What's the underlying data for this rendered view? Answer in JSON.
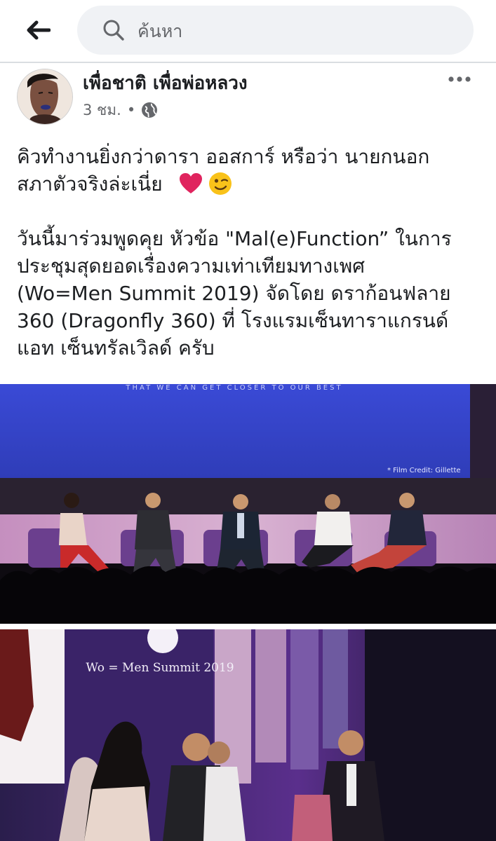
{
  "search": {
    "placeholder": "ค้นหา"
  },
  "post": {
    "author": "เพื่อชาติ เพื่อพ่อหลวง",
    "time": "3 ชม.",
    "separator": "•",
    "text_lines_1": [
      "คิวทำงานยิ่งกว่าดารา  ออสการ์ หรือว่า นายกนอก",
      "สภาตัวจริงล่ะเนี่ย"
    ],
    "text_lines_2": [
      "วันนี้มาร่วมพูดคุย หัวข้อ \"Mal(e)Function” ในการ",
      "ประชุมสุดยอดเรื่องความเท่าเทียมทางเพศ",
      "(Wo=Men Summit 2019) จัดโดย ดราก้อนฟลาย",
      "360 (Dragonfly 360) ที่ โรงแรมเซ็นทาราแกรนด์",
      "แอท เซ็นทรัลเวิลด์ ครับ"
    ]
  },
  "photo1": {
    "screen_caption": "THAT WE CAN GET CLOSER TO OUR BEST",
    "film_credit": "* Film Credit: Gillette"
  },
  "photo2": {
    "banner_text": "Wo = Men Summit 2019"
  },
  "colors": {
    "stage_blue": "#3f4ed2",
    "stage_purple": "#4a2a78",
    "chair_purple": "#6b3f8e",
    "heart": "#e0245e",
    "search_bg": "#f0f2f5",
    "text": "#1c1e21",
    "muted": "#65676b"
  },
  "icons": [
    "back-arrow-icon",
    "search-icon",
    "globe-icon",
    "more-dots-icon",
    "heart-emoji-icon",
    "wink-emoji-icon"
  ]
}
